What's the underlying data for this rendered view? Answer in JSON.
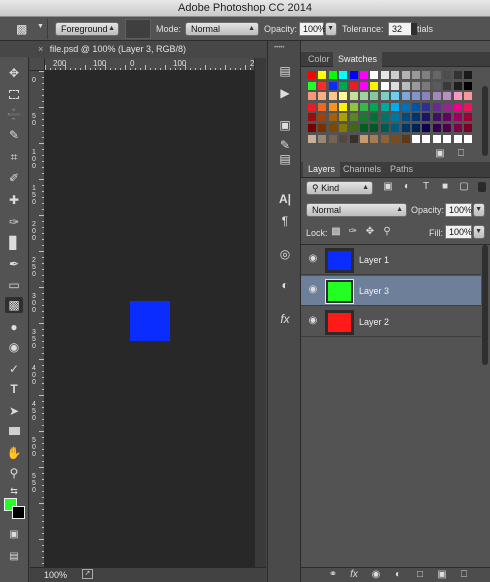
{
  "window": {
    "title": "Adobe Photoshop CC 2014"
  },
  "options_bar": {
    "fill_source": "Foreground",
    "mode_label": "Mode:",
    "mode_value": "Normal",
    "opacity_label": "Opacity:",
    "opacity_value": "100%",
    "tolerance_label": "Tolerance:",
    "tolerance_value": "32",
    "antialias_fragment": "tials"
  },
  "document": {
    "tab_label": "file.psd @ 100% (Layer 3, RGB/8)",
    "zoom": "100%",
    "h_ruler_labels": [
      "200",
      "100",
      "0",
      "100",
      "2"
    ],
    "v_ruler_labels": [
      "0",
      "5 0",
      "1 0 0",
      "1 5 0",
      "2 0 0",
      "2 5 0",
      "3 0 0",
      "3 5 0",
      "4 0 0",
      "4 5 0",
      "5 0 0",
      "5 5 0"
    ],
    "canvas_object_color": "#0a2cff"
  },
  "tools": {
    "foreground_color": "#22ff22",
    "background_color": "#000000"
  },
  "color_panel": {
    "tabs": [
      "Color",
      "Swatches"
    ],
    "active_tab": "Swatches"
  },
  "layers_panel": {
    "tabs": [
      "Layers",
      "Channels",
      "Paths"
    ],
    "active_tab": "Layers",
    "filter_kind": "Kind",
    "blend_mode": "Normal",
    "opacity_label": "Opacity:",
    "opacity_value": "100%",
    "lock_label": "Lock:",
    "fill_label": "Fill:",
    "fill_value": "100%",
    "layers": [
      {
        "name": "Layer 1",
        "color": "#0a2cff",
        "selected": false
      },
      {
        "name": "Layer 3",
        "color": "#22ff22",
        "selected": true
      },
      {
        "name": "Layer 2",
        "color": "#ff1a1a",
        "selected": false
      }
    ]
  }
}
